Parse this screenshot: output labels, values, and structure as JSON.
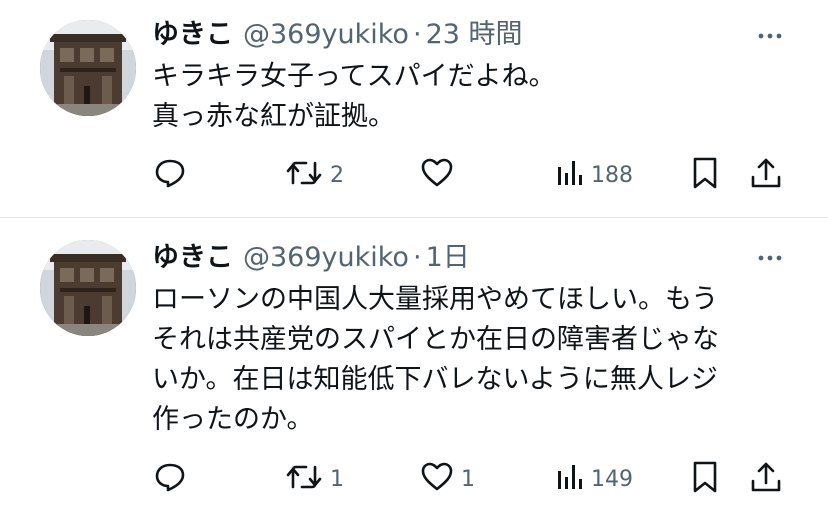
{
  "tweets": [
    {
      "display_name": "ゆきこ",
      "handle": "@369yukiko",
      "separator": "·",
      "time": "23 時間",
      "text": "キラキラ女子ってスパイだよね。\n真っ赤な紅が証拠。",
      "reply_count": "",
      "retweet_count": "2",
      "like_count": "",
      "views": "188"
    },
    {
      "display_name": "ゆきこ",
      "handle": "@369yukiko",
      "separator": "·",
      "time": "1日",
      "text": "ローソンの中国人大量採用やめてほしい。もう\nそれは共産党のスパイとか在日の障害者じゃな\nいか。在日は知能低下バレないように無人レジ\n作ったのか。",
      "reply_count": "",
      "retweet_count": "1",
      "like_count": "1",
      "views": "149"
    }
  ],
  "icons": {
    "reply": "reply-icon",
    "retweet": "retweet-icon",
    "like": "heart-icon",
    "views": "views-icon",
    "bookmark": "bookmark-icon",
    "share": "share-icon",
    "more": "more-icon"
  },
  "colors": {
    "text_primary": "#0f1419",
    "text_secondary": "#536471",
    "divider": "#e6e9ec"
  }
}
